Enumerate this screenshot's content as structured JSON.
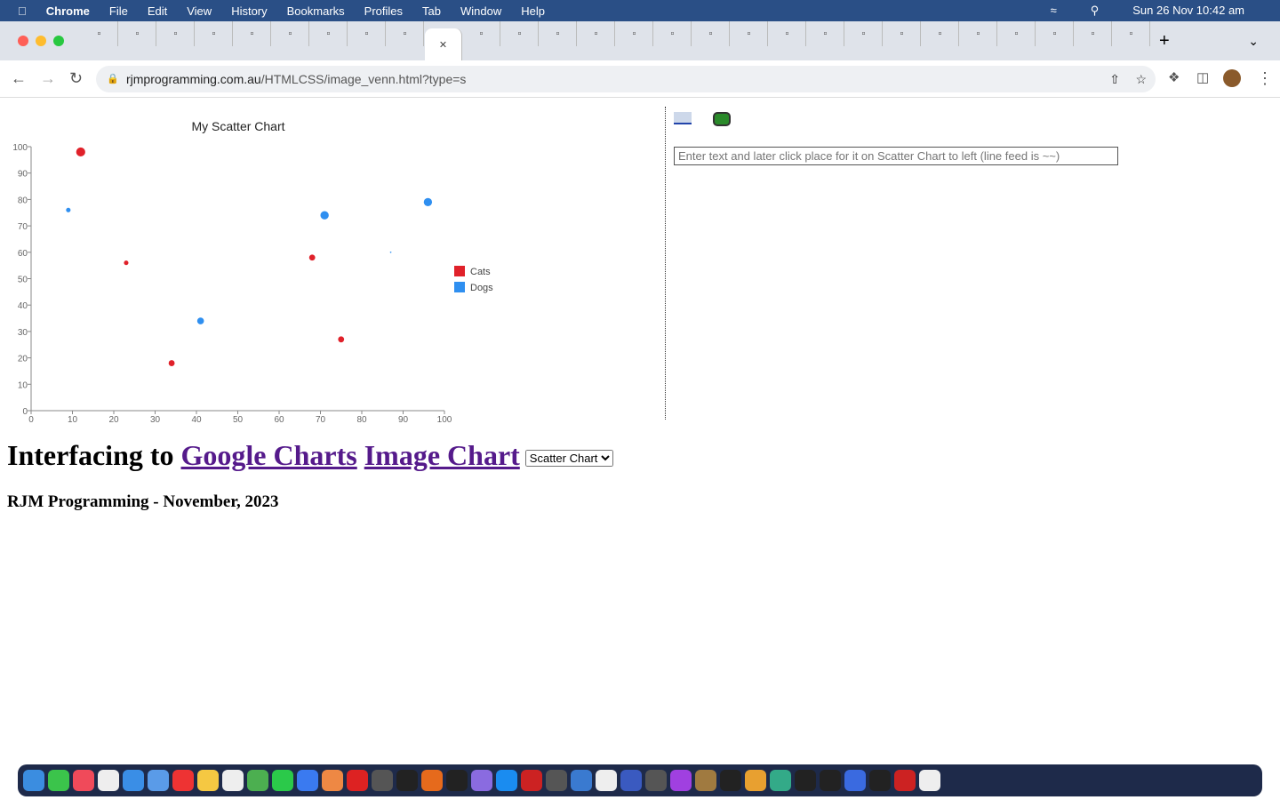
{
  "menubar": {
    "app": "Chrome",
    "items": [
      "File",
      "Edit",
      "View",
      "History",
      "Bookmarks",
      "Profiles",
      "Tab",
      "Window",
      "Help"
    ],
    "clock": "Sun 26 Nov  10:42 am"
  },
  "browser": {
    "url_domain": "rjmprogramming.com.au",
    "url_path": "/HTMLCSS/image_venn.html?type=s"
  },
  "right_panel": {
    "input_placeholder": "Enter text and later click place for it on Scatter Chart to left (line feed is ~~)"
  },
  "heading": {
    "prefix": "Interfacing to ",
    "link1": "Google Charts",
    "link2": "Image Chart",
    "select_value": "Scatter Chart"
  },
  "subheading": "RJM Programming - November, 2023",
  "chart_data": {
    "type": "scatter",
    "title": "My Scatter Chart",
    "xlabel": "",
    "ylabel": "",
    "xlim": [
      0,
      100
    ],
    "ylim": [
      0,
      100
    ],
    "xticks": [
      0,
      10,
      20,
      30,
      40,
      50,
      60,
      70,
      80,
      90,
      100
    ],
    "yticks": [
      0,
      10,
      20,
      30,
      40,
      50,
      60,
      70,
      80,
      90,
      100
    ],
    "grid": false,
    "legend": "right",
    "series": [
      {
        "name": "Cats",
        "color": "#e0212a",
        "points": [
          {
            "x": 12,
            "y": 98,
            "size": 6
          },
          {
            "x": 23,
            "y": 56,
            "size": 3
          },
          {
            "x": 34,
            "y": 18,
            "size": 4
          },
          {
            "x": 68,
            "y": 58,
            "size": 4
          },
          {
            "x": 75,
            "y": 27,
            "size": 4
          }
        ]
      },
      {
        "name": "Dogs",
        "color": "#2f8ff0",
        "points": [
          {
            "x": 9,
            "y": 76,
            "size": 3
          },
          {
            "x": 41,
            "y": 34,
            "size": 4.5
          },
          {
            "x": 71,
            "y": 74,
            "size": 5.5
          },
          {
            "x": 96,
            "y": 79,
            "size": 5.5
          },
          {
            "x": 87,
            "y": 60,
            "size": 1
          }
        ]
      }
    ]
  }
}
